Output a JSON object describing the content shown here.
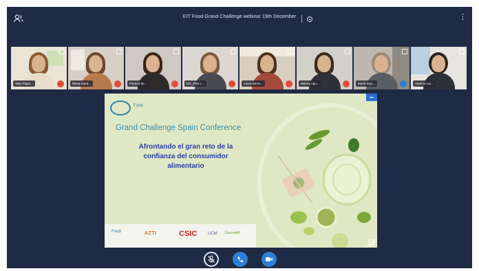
{
  "header": {
    "title": "EIT Food Grand Challenge webinar 19th December"
  },
  "participants": [
    {
      "name": "Sara Pajan...",
      "muted": true
    },
    {
      "name": "Elena Sand...",
      "muted": true
    },
    {
      "name": "Pastora M...",
      "muted": true
    },
    {
      "name": "EIT_Pilot L...",
      "muted": true
    },
    {
      "name": "Laura Serra...",
      "muted": true
    },
    {
      "name": "Marina Agu...",
      "muted": true
    },
    {
      "name": "Marta Ingo...",
      "muted": false
    },
    {
      "name": "Antonio Lut...",
      "muted": true
    }
  ],
  "slide": {
    "logo_text": "Food",
    "title": "Grand Challenge Spain Conference",
    "subtitle_lines": [
      "Afrontando el gran reto de la",
      "confianza del consumidor",
      "alimentario"
    ],
    "partners": {
      "etc": "Food",
      "azti": "AZTI",
      "csic": "CSIC",
      "ucm": "UCM",
      "green": "GreenAM"
    }
  },
  "colors": {
    "background": "#1f2a44",
    "accent_blue": "#2d7fd6",
    "mute_red": "#e24b36",
    "slide_bg": "#dfe8c4"
  },
  "icons": {
    "users": "users-icon",
    "record": "record-icon",
    "menu": "kebab-menu-icon",
    "mic": "mic-off-icon",
    "phone": "phone-icon",
    "camera": "camera-icon"
  }
}
